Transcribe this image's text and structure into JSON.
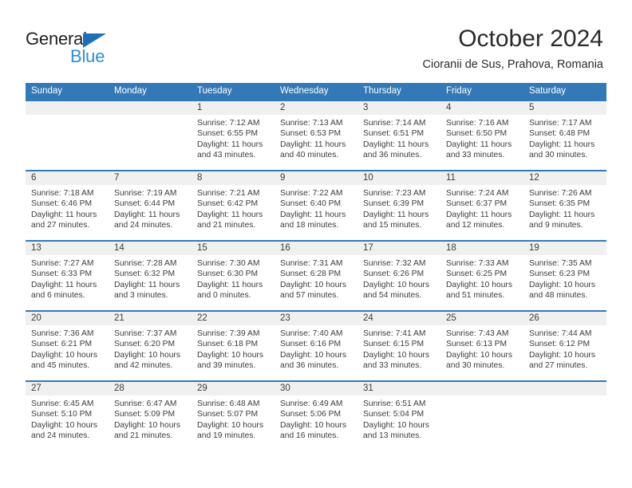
{
  "brand": {
    "name_top": "General",
    "name_bottom": "Blue",
    "color_dark": "#231f20",
    "color_blue": "#2b8fd4",
    "triangle_color": "#1f6fb8"
  },
  "header": {
    "title": "October 2024",
    "subtitle": "Cioranii de Sus, Prahova, Romania"
  },
  "theme": {
    "header_bg": "#3479b7",
    "header_text": "#ffffff",
    "date_band_bg": "#f0f0f0",
    "cell_bg": "#ffffff",
    "text": "#3d3d3d"
  },
  "weekdays": [
    "Sunday",
    "Monday",
    "Tuesday",
    "Wednesday",
    "Thursday",
    "Friday",
    "Saturday"
  ],
  "weeks": [
    [
      {
        "date": "",
        "sunrise": "",
        "sunset": "",
        "daylight_a": "",
        "daylight_b": ""
      },
      {
        "date": "",
        "sunrise": "",
        "sunset": "",
        "daylight_a": "",
        "daylight_b": ""
      },
      {
        "date": "1",
        "sunrise": "Sunrise: 7:12 AM",
        "sunset": "Sunset: 6:55 PM",
        "daylight_a": "Daylight: 11 hours",
        "daylight_b": "and 43 minutes."
      },
      {
        "date": "2",
        "sunrise": "Sunrise: 7:13 AM",
        "sunset": "Sunset: 6:53 PM",
        "daylight_a": "Daylight: 11 hours",
        "daylight_b": "and 40 minutes."
      },
      {
        "date": "3",
        "sunrise": "Sunrise: 7:14 AM",
        "sunset": "Sunset: 6:51 PM",
        "daylight_a": "Daylight: 11 hours",
        "daylight_b": "and 36 minutes."
      },
      {
        "date": "4",
        "sunrise": "Sunrise: 7:16 AM",
        "sunset": "Sunset: 6:50 PM",
        "daylight_a": "Daylight: 11 hours",
        "daylight_b": "and 33 minutes."
      },
      {
        "date": "5",
        "sunrise": "Sunrise: 7:17 AM",
        "sunset": "Sunset: 6:48 PM",
        "daylight_a": "Daylight: 11 hours",
        "daylight_b": "and 30 minutes."
      }
    ],
    [
      {
        "date": "6",
        "sunrise": "Sunrise: 7:18 AM",
        "sunset": "Sunset: 6:46 PM",
        "daylight_a": "Daylight: 11 hours",
        "daylight_b": "and 27 minutes."
      },
      {
        "date": "7",
        "sunrise": "Sunrise: 7:19 AM",
        "sunset": "Sunset: 6:44 PM",
        "daylight_a": "Daylight: 11 hours",
        "daylight_b": "and 24 minutes."
      },
      {
        "date": "8",
        "sunrise": "Sunrise: 7:21 AM",
        "sunset": "Sunset: 6:42 PM",
        "daylight_a": "Daylight: 11 hours",
        "daylight_b": "and 21 minutes."
      },
      {
        "date": "9",
        "sunrise": "Sunrise: 7:22 AM",
        "sunset": "Sunset: 6:40 PM",
        "daylight_a": "Daylight: 11 hours",
        "daylight_b": "and 18 minutes."
      },
      {
        "date": "10",
        "sunrise": "Sunrise: 7:23 AM",
        "sunset": "Sunset: 6:39 PM",
        "daylight_a": "Daylight: 11 hours",
        "daylight_b": "and 15 minutes."
      },
      {
        "date": "11",
        "sunrise": "Sunrise: 7:24 AM",
        "sunset": "Sunset: 6:37 PM",
        "daylight_a": "Daylight: 11 hours",
        "daylight_b": "and 12 minutes."
      },
      {
        "date": "12",
        "sunrise": "Sunrise: 7:26 AM",
        "sunset": "Sunset: 6:35 PM",
        "daylight_a": "Daylight: 11 hours",
        "daylight_b": "and 9 minutes."
      }
    ],
    [
      {
        "date": "13",
        "sunrise": "Sunrise: 7:27 AM",
        "sunset": "Sunset: 6:33 PM",
        "daylight_a": "Daylight: 11 hours",
        "daylight_b": "and 6 minutes."
      },
      {
        "date": "14",
        "sunrise": "Sunrise: 7:28 AM",
        "sunset": "Sunset: 6:32 PM",
        "daylight_a": "Daylight: 11 hours",
        "daylight_b": "and 3 minutes."
      },
      {
        "date": "15",
        "sunrise": "Sunrise: 7:30 AM",
        "sunset": "Sunset: 6:30 PM",
        "daylight_a": "Daylight: 11 hours",
        "daylight_b": "and 0 minutes."
      },
      {
        "date": "16",
        "sunrise": "Sunrise: 7:31 AM",
        "sunset": "Sunset: 6:28 PM",
        "daylight_a": "Daylight: 10 hours",
        "daylight_b": "and 57 minutes."
      },
      {
        "date": "17",
        "sunrise": "Sunrise: 7:32 AM",
        "sunset": "Sunset: 6:26 PM",
        "daylight_a": "Daylight: 10 hours",
        "daylight_b": "and 54 minutes."
      },
      {
        "date": "18",
        "sunrise": "Sunrise: 7:33 AM",
        "sunset": "Sunset: 6:25 PM",
        "daylight_a": "Daylight: 10 hours",
        "daylight_b": "and 51 minutes."
      },
      {
        "date": "19",
        "sunrise": "Sunrise: 7:35 AM",
        "sunset": "Sunset: 6:23 PM",
        "daylight_a": "Daylight: 10 hours",
        "daylight_b": "and 48 minutes."
      }
    ],
    [
      {
        "date": "20",
        "sunrise": "Sunrise: 7:36 AM",
        "sunset": "Sunset: 6:21 PM",
        "daylight_a": "Daylight: 10 hours",
        "daylight_b": "and 45 minutes."
      },
      {
        "date": "21",
        "sunrise": "Sunrise: 7:37 AM",
        "sunset": "Sunset: 6:20 PM",
        "daylight_a": "Daylight: 10 hours",
        "daylight_b": "and 42 minutes."
      },
      {
        "date": "22",
        "sunrise": "Sunrise: 7:39 AM",
        "sunset": "Sunset: 6:18 PM",
        "daylight_a": "Daylight: 10 hours",
        "daylight_b": "and 39 minutes."
      },
      {
        "date": "23",
        "sunrise": "Sunrise: 7:40 AM",
        "sunset": "Sunset: 6:16 PM",
        "daylight_a": "Daylight: 10 hours",
        "daylight_b": "and 36 minutes."
      },
      {
        "date": "24",
        "sunrise": "Sunrise: 7:41 AM",
        "sunset": "Sunset: 6:15 PM",
        "daylight_a": "Daylight: 10 hours",
        "daylight_b": "and 33 minutes."
      },
      {
        "date": "25",
        "sunrise": "Sunrise: 7:43 AM",
        "sunset": "Sunset: 6:13 PM",
        "daylight_a": "Daylight: 10 hours",
        "daylight_b": "and 30 minutes."
      },
      {
        "date": "26",
        "sunrise": "Sunrise: 7:44 AM",
        "sunset": "Sunset: 6:12 PM",
        "daylight_a": "Daylight: 10 hours",
        "daylight_b": "and 27 minutes."
      }
    ],
    [
      {
        "date": "27",
        "sunrise": "Sunrise: 6:45 AM",
        "sunset": "Sunset: 5:10 PM",
        "daylight_a": "Daylight: 10 hours",
        "daylight_b": "and 24 minutes."
      },
      {
        "date": "28",
        "sunrise": "Sunrise: 6:47 AM",
        "sunset": "Sunset: 5:09 PM",
        "daylight_a": "Daylight: 10 hours",
        "daylight_b": "and 21 minutes."
      },
      {
        "date": "29",
        "sunrise": "Sunrise: 6:48 AM",
        "sunset": "Sunset: 5:07 PM",
        "daylight_a": "Daylight: 10 hours",
        "daylight_b": "and 19 minutes."
      },
      {
        "date": "30",
        "sunrise": "Sunrise: 6:49 AM",
        "sunset": "Sunset: 5:06 PM",
        "daylight_a": "Daylight: 10 hours",
        "daylight_b": "and 16 minutes."
      },
      {
        "date": "31",
        "sunrise": "Sunrise: 6:51 AM",
        "sunset": "Sunset: 5:04 PM",
        "daylight_a": "Daylight: 10 hours",
        "daylight_b": "and 13 minutes."
      },
      {
        "date": "",
        "sunrise": "",
        "sunset": "",
        "daylight_a": "",
        "daylight_b": ""
      },
      {
        "date": "",
        "sunrise": "",
        "sunset": "",
        "daylight_a": "",
        "daylight_b": ""
      }
    ]
  ]
}
